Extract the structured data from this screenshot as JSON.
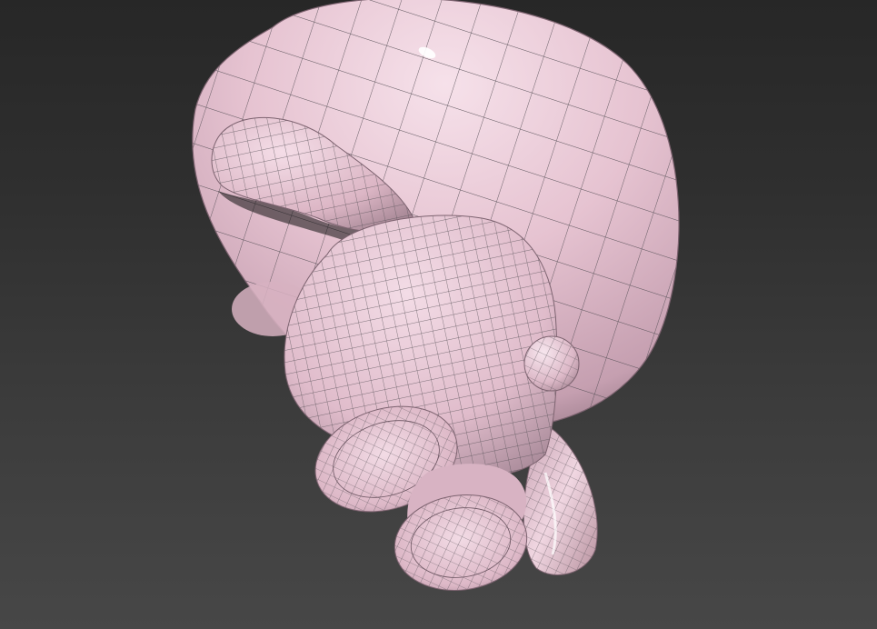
{
  "viewport": {
    "background_top": "#262626",
    "background_bottom": "#474747",
    "shading_mode": "smooth-highlights-edged-faces"
  },
  "model": {
    "material_color": "#e7c4d2",
    "material_shadow": "#9c7f8c",
    "material_highlight": "#fbeef4",
    "wire_color": "#555055",
    "parts": [
      "head",
      "ear",
      "torso",
      "nose-bump",
      "foot-left",
      "foot-right",
      "tail"
    ]
  }
}
